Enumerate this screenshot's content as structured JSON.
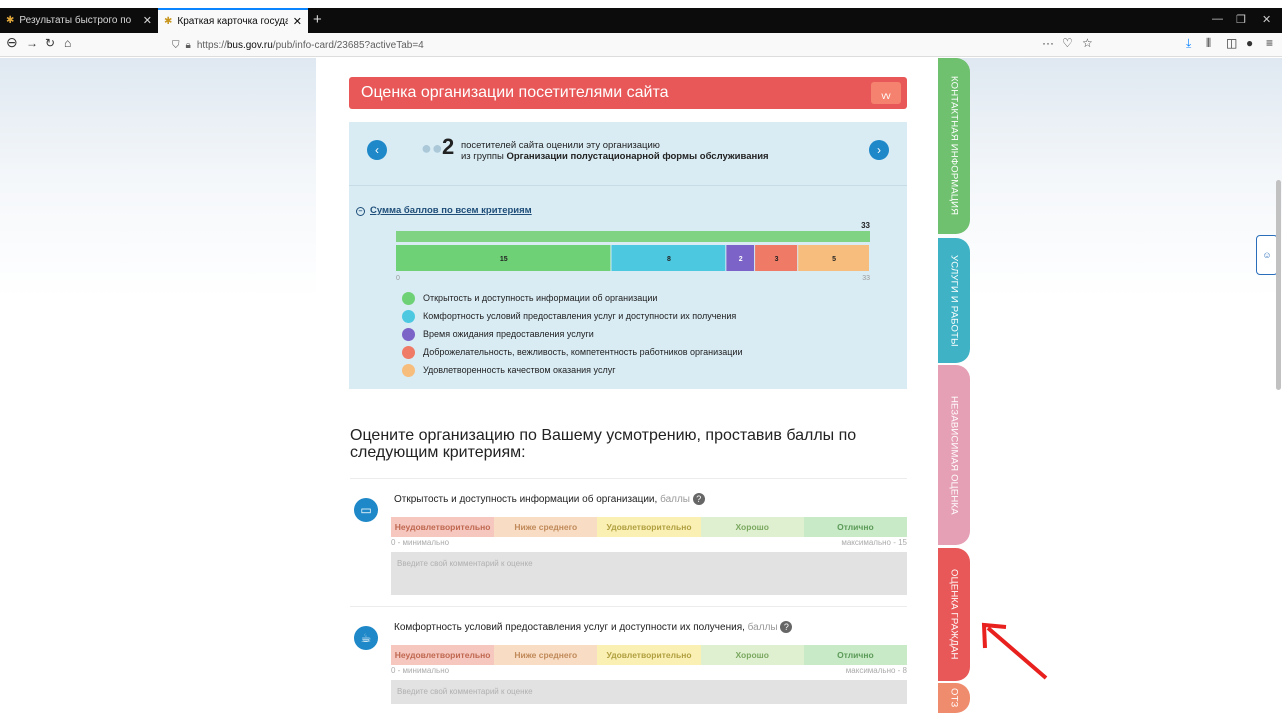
{
  "browser": {
    "tabs": [
      {
        "label": "Результаты быстрого поиска"
      },
      {
        "label": "Краткая карточка государстве"
      }
    ],
    "url_prefix": "https://",
    "url_host": "bus.gov.ru",
    "url_path": "/pub/info-card/23685?activeTab=4"
  },
  "header": {
    "title": "Оценка организации посетителями сайта"
  },
  "summary": {
    "count": "2",
    "line1": "посетителей сайта оценили эту организацию",
    "line2_prefix": "из группы ",
    "line2_group": "Организации полустационарной формы обслуживания",
    "sum_link": "Сумма баллов по всем критериям"
  },
  "chart_data": {
    "type": "bar",
    "total": 33,
    "xlim": [
      0,
      33
    ],
    "tick_labels": [
      "0",
      "33"
    ],
    "series": [
      {
        "name": "Открытость и доступность информации об организации",
        "value": 15,
        "color": "#6fd175"
      },
      {
        "name": "Комфортность условий предоставления услуг и доступности их получения",
        "value": 8,
        "color": "#4cc9e1"
      },
      {
        "name": "Время ожидания предоставления услуги",
        "value": 2,
        "color": "#7b63c7"
      },
      {
        "name": "Доброжелательность, вежливость, компетентность работников организации",
        "value": 3,
        "color": "#ef7a66"
      },
      {
        "name": "Удовлетворенность качеством оказания услуг",
        "value": 5,
        "color": "#f7bd7c"
      }
    ],
    "total_color": "#7fd383"
  },
  "rate_prompt": "Оцените организацию по Вашему усмотрению, проставив баллы по следующим критериям:",
  "scale": [
    "Неудовлетворительно",
    "Ниже среднего",
    "Удовлетворительно",
    "Хорошо",
    "Отлично"
  ],
  "criteria": [
    {
      "title": "Открытость и доступность информации об организации,",
      "unit": "баллы",
      "min": "0 - минимально",
      "max": "максимально - 15",
      "placeholder": "Введите свой комментарий к оценке"
    },
    {
      "title": "Комфортность условий предоставления услуг и доступности их получения,",
      "unit": "баллы",
      "min": "0 - минимально",
      "max": "максимально - 8",
      "placeholder": "Введите свой комментарий к оценке"
    }
  ],
  "side_tabs": [
    {
      "label": "КОНТАКТНАЯ ИНФОРМАЦИЯ",
      "color": "#6fc06f"
    },
    {
      "label": "УСЛУГИ И РАБОТЫ",
      "color": "#3fb3c5"
    },
    {
      "label": "НЕЗАВИСИМАЯ ОЦЕНКА",
      "color": "#e6a0b6"
    },
    {
      "label": "ОЦЕНКА ГРАЖДАН",
      "color": "#e85858"
    },
    {
      "label": "ОТЗ",
      "color": "#f08c6e"
    }
  ],
  "colors": {
    "arrow": "#e8201e"
  }
}
